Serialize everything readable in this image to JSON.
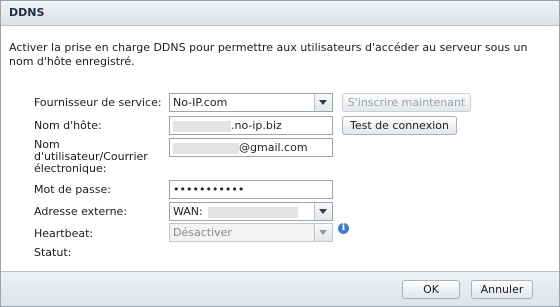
{
  "dialog": {
    "title": "DDNS"
  },
  "description": "Activer la prise en charge DDNS pour permettre aux utilisateurs d'accéder au serveur sous un nom d'hôte enregistré.",
  "form": {
    "provider_label": "Fournisseur de service:",
    "provider_value": "No-IP.com",
    "register_label": "S'inscrire maintenant",
    "hostname_label": "Nom d'hôte:",
    "hostname_suffix": ".no-ip.biz",
    "test_label": "Test de connexion",
    "username_label": "Nom d'utilisateur/Courrier électronique:",
    "username_suffix": "@gmail.com",
    "password_label": "Mot de passe:",
    "password_value": "•••••••••••",
    "external_label": "Adresse externe:",
    "external_prefix": "WAN:",
    "heartbeat_label": "Heartbeat:",
    "heartbeat_value": "Désactiver",
    "status_label": "Statut:"
  },
  "footer": {
    "ok_label": "OK",
    "cancel_label": "Annuler"
  },
  "icons": {
    "info": "info-icon",
    "dropdown": "chevron-down-icon"
  }
}
